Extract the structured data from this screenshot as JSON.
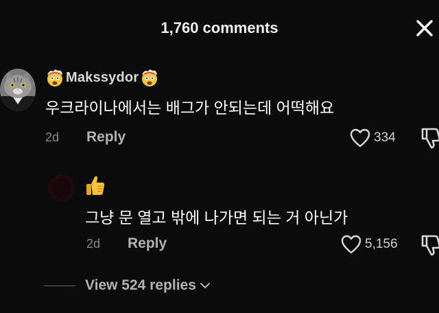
{
  "header": {
    "title": "1,760 comments",
    "close_icon": "close-icon"
  },
  "comments": [
    {
      "username": "Makssydor",
      "username_emoji": "exploding-head-emoji",
      "avatar": "cat-avatar",
      "text": "우크라이나에서는 배그가 안되는데 어떡해요",
      "date": "2d",
      "reply_label": "Reply",
      "likes": "334"
    },
    {
      "avatar": "dark-avatar",
      "username_emoji": "thumbs-up-emoji",
      "text": "그냥 문 열고 밖에 나가면 되는 거 아닌가",
      "date": "2d",
      "reply_label": "Reply",
      "likes": "5,156"
    }
  ],
  "view_replies": {
    "label": "View 524 replies"
  },
  "colors": {
    "background": "#0b0b0b",
    "primary_text": "#ffffff",
    "secondary_text": "#b3b3b3",
    "muted_text": "#8a8a8a"
  }
}
